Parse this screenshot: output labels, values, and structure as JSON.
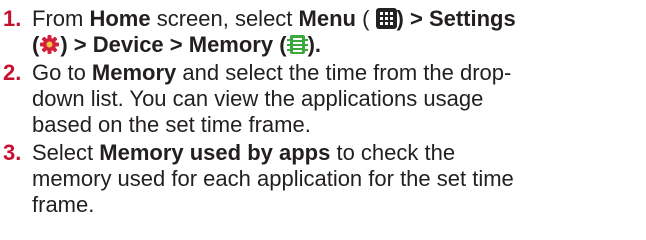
{
  "steps": [
    {
      "number": "1.",
      "parts": {
        "t1": "From ",
        "b1": "Home",
        "t2": " screen, select ",
        "b2": "Menu",
        "t3": " ( ",
        "b3": ") > Settings",
        "t4": "(",
        "b4": ") > Device > Memory",
        "t5": " (",
        "t6": ")."
      }
    },
    {
      "number": "2.",
      "parts": {
        "t1": "Go to ",
        "b1": "Memory",
        "t2": " and select the time from the drop-",
        "t3": "down list. You can view the applications usage",
        "t4": "based on the set time frame."
      }
    },
    {
      "number": "3.",
      "parts": {
        "t1": "Select ",
        "b1": "Memory used by apps",
        "t2": " to check the",
        "t3": "memory used for each application for the set time",
        "t4": "frame."
      }
    }
  ],
  "icons": {
    "menu": "menu-grid-icon",
    "settings": "settings-gear-icon",
    "memory": "memory-chip-icon"
  },
  "colors": {
    "step_number": "#c8102e",
    "text": "#231f20",
    "menu_icon_bg": "#222222",
    "settings_icon": "#d3203a",
    "memory_icon": "#3aa83a"
  }
}
